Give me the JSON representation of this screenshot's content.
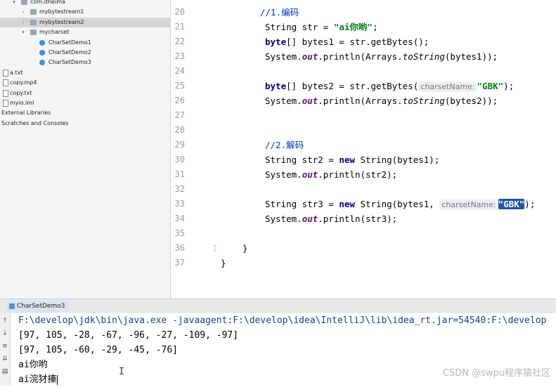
{
  "tree": {
    "items": [
      {
        "label": "com.itheima",
        "kind": "pkg",
        "arrow": "▾",
        "indent": 0
      },
      {
        "label": "mybytestream1",
        "kind": "pkg",
        "arrow": "›",
        "indent": 1
      },
      {
        "label": "mybytestream2",
        "kind": "pkg",
        "arrow": "›",
        "indent": 1,
        "selected": true
      },
      {
        "label": "mycharset",
        "kind": "pkg",
        "arrow": "▾",
        "indent": 1
      },
      {
        "label": "CharSetDemo1",
        "kind": "cls",
        "arrow": "",
        "indent": 2
      },
      {
        "label": "CharSetDemo2",
        "kind": "cls",
        "arrow": "",
        "indent": 2
      },
      {
        "label": "CharSetDemo3",
        "kind": "cls",
        "arrow": "",
        "indent": 2
      },
      {
        "label": "a.txt",
        "kind": "file",
        "arrow": "",
        "indent": -1
      },
      {
        "label": "copy.mp4",
        "kind": "file",
        "arrow": "",
        "indent": -1
      },
      {
        "label": "copy.txt",
        "kind": "file",
        "arrow": "",
        "indent": -1
      },
      {
        "label": "myio.iml",
        "kind": "file",
        "arrow": "",
        "indent": -1
      },
      {
        "label": "External Libraries",
        "kind": "none",
        "arrow": "",
        "indent": -2
      },
      {
        "label": "Scratches and Consoles",
        "kind": "none",
        "arrow": "",
        "indent": -2
      }
    ]
  },
  "editor": {
    "line_numbers": [
      "20",
      "21",
      "22",
      "23",
      "24",
      "25",
      "26",
      "27",
      "28",
      "29",
      "30",
      "31",
      "32",
      "33",
      "34",
      "35",
      "36",
      "37"
    ],
    "l20": "//1.编码",
    "l21a": "String str = ",
    "l21b": "\"ai你哟\"",
    "l21c": ";",
    "l22a": "byte",
    "l22b": "[] bytes1 = str.getBytes();",
    "l23a": "System.",
    "l23b": "out",
    "l23c": ".println(Arrays.",
    "l23d": "toString",
    "l23e": "(bytes1));",
    "l25a": "byte",
    "l25b": "[] bytes2 = str.getBytes(",
    "l25hint": "charsetName:",
    "l25c": "\"GBK\"",
    "l25d": ");",
    "l26a": "System.",
    "l26b": "out",
    "l26c": ".println(Arrays.",
    "l26d": "toString",
    "l26e": "(bytes2));",
    "l29": "//2.解码",
    "l30a": "String str2 = ",
    "l30b": "new",
    "l30c": " String(bytes1);",
    "l31a": "System.",
    "l31b": "out",
    "l31c": ".println(str2);",
    "l33a": "String str3 = ",
    "l33b": "new",
    "l33c": " String(bytes1, ",
    "l33hint": "charsetName:",
    "l33d": "\"GBK\"",
    "l33e": ");",
    "l34a": "System.",
    "l34b": "out",
    "l34c": ".println(str3);",
    "l36": "}",
    "l37": "}"
  },
  "run": {
    "tab_label": "CharSetDemo3",
    "lines": [
      "F:\\develop\\jdk\\bin\\java.exe -javaagent:F:\\develop\\idea\\IntelliJ\\lib\\idea_rt.jar=54540:F:\\develop",
      "[97, 105, -28, -67, -96, -27, -109, -97]",
      "[97, 105, -60, -29, -45, -76]",
      "ai你哟",
      "ai浣犲搸"
    ]
  },
  "watermark": "CSDN @swpu程序猿社区"
}
